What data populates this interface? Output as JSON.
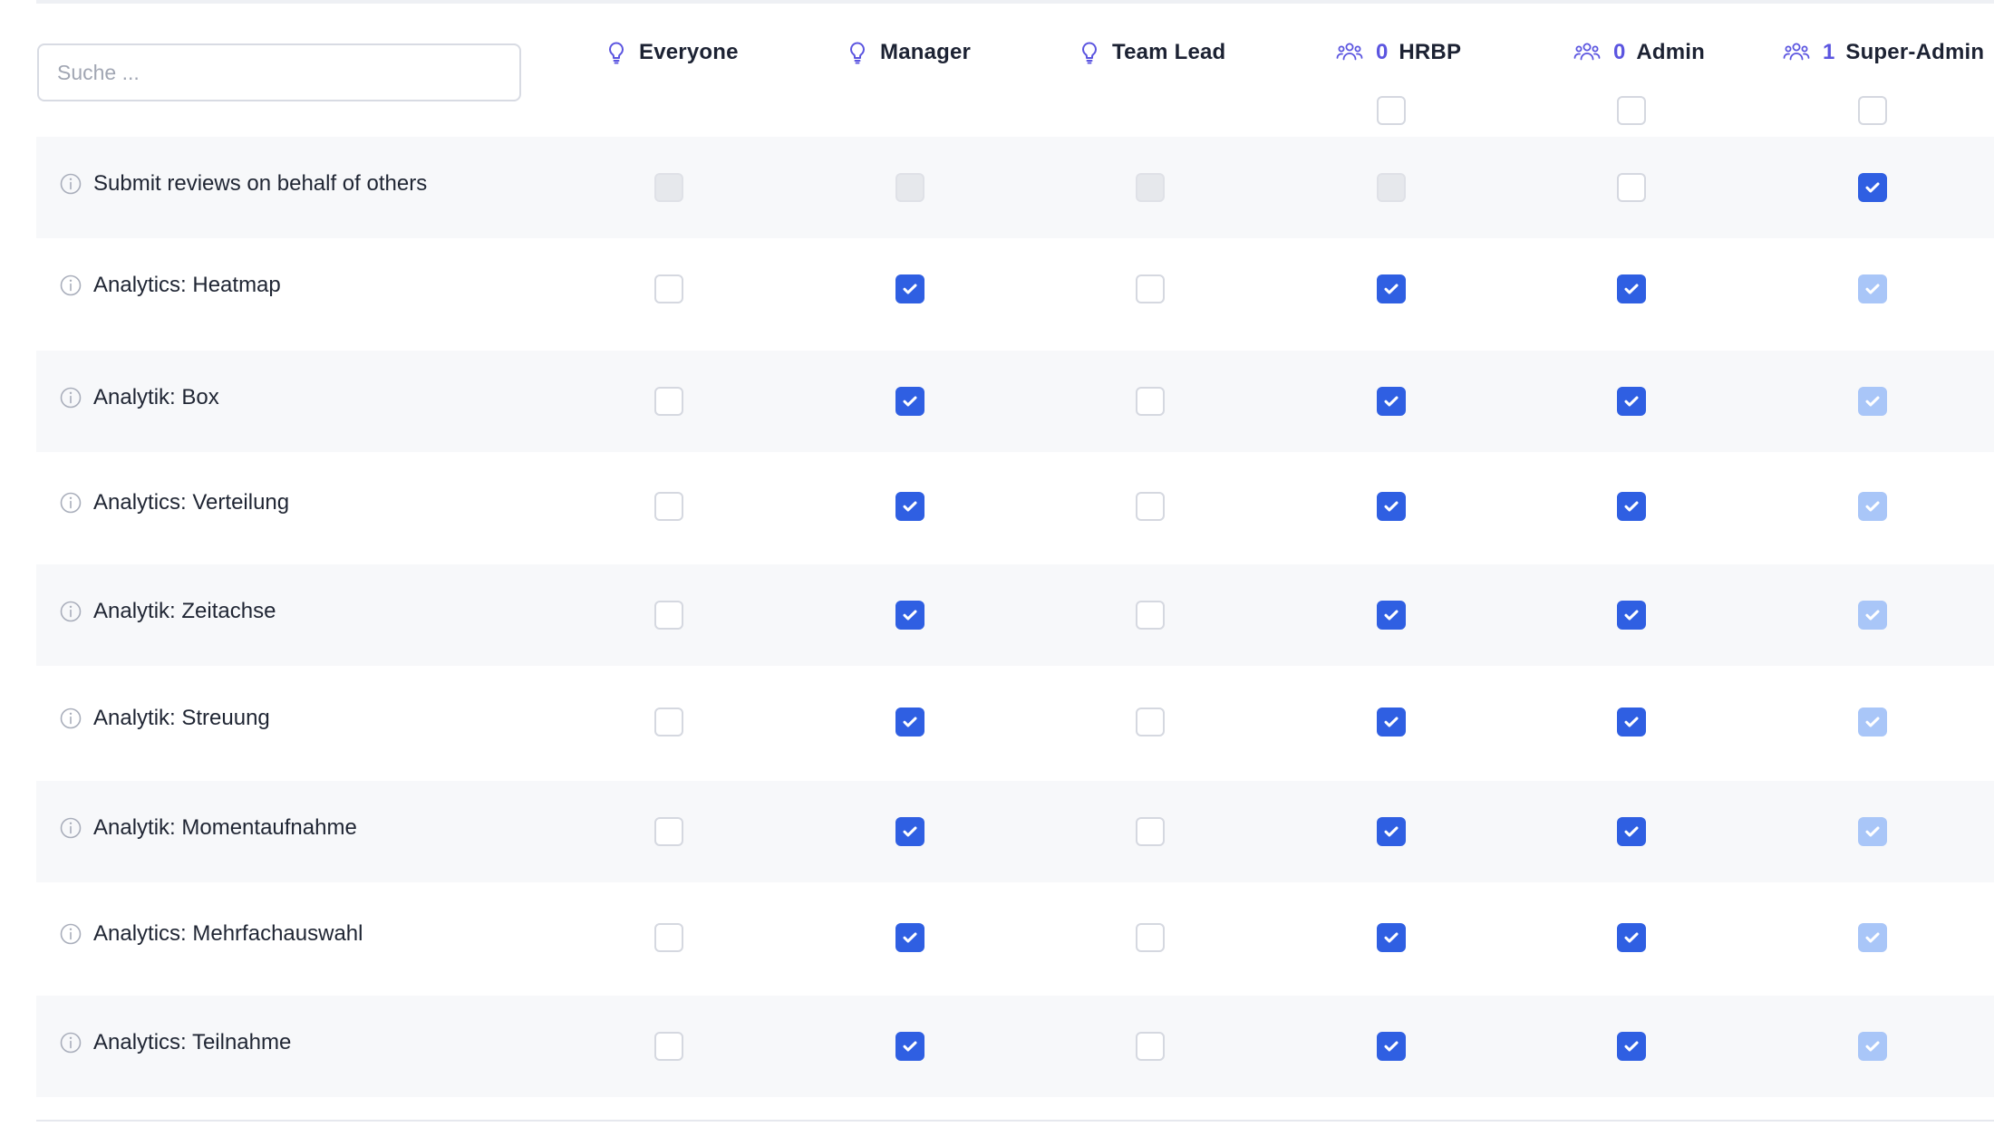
{
  "search": {
    "placeholder": "Suche ...",
    "value": ""
  },
  "colors": {
    "accent": "#2f5fe2",
    "accent_muted": "#a9c6f8",
    "role_icon": "#5b55e0",
    "row_shade": "#f7f8fa",
    "disabled_fill": "#e6e8ec"
  },
  "columns": [
    {
      "key": "everyone",
      "label": "Everyone",
      "icon": "lightbulb-icon",
      "count": ""
    },
    {
      "key": "manager",
      "label": "Manager",
      "icon": "lightbulb-icon",
      "count": ""
    },
    {
      "key": "team_lead",
      "label": "Team Lead",
      "icon": "lightbulb-icon",
      "count": ""
    },
    {
      "key": "hrbp",
      "label": "HRBP",
      "icon": "users-group-icon",
      "count": "0"
    },
    {
      "key": "admin",
      "label": "Admin",
      "icon": "users-group-icon",
      "count": "0"
    },
    {
      "key": "super_admin",
      "label": "Super-Admin",
      "icon": "users-group-icon",
      "count": "1"
    }
  ],
  "select_all": [
    "",
    "",
    "",
    "unchecked",
    "unchecked",
    "unchecked"
  ],
  "permissions": [
    {
      "label": "Submit reviews on behalf of others",
      "states": [
        "disabled",
        "disabled",
        "disabled",
        "disabled",
        "unchecked",
        "checked"
      ]
    },
    {
      "label": "Analytics: Heatmap",
      "states": [
        "unchecked",
        "checked",
        "unchecked",
        "checked",
        "checked",
        "checked-muted"
      ]
    },
    {
      "label": "Analytik: Box",
      "states": [
        "unchecked",
        "checked",
        "unchecked",
        "checked",
        "checked",
        "checked-muted"
      ]
    },
    {
      "label": "Analytics: Verteilung",
      "states": [
        "unchecked",
        "checked",
        "unchecked",
        "checked",
        "checked",
        "checked-muted"
      ]
    },
    {
      "label": "Analytik: Zeitachse",
      "states": [
        "unchecked",
        "checked",
        "unchecked",
        "checked",
        "checked",
        "checked-muted"
      ]
    },
    {
      "label": "Analytik: Streuung",
      "states": [
        "unchecked",
        "checked",
        "unchecked",
        "checked",
        "checked",
        "checked-muted"
      ]
    },
    {
      "label": "Analytik: Momentaufnahme",
      "states": [
        "unchecked",
        "checked",
        "unchecked",
        "checked",
        "checked",
        "checked-muted"
      ]
    },
    {
      "label": "Analytics: Mehrfachauswahl",
      "states": [
        "unchecked",
        "checked",
        "unchecked",
        "checked",
        "checked",
        "checked-muted"
      ]
    },
    {
      "label": "Analytics: Teilnahme",
      "states": [
        "unchecked",
        "checked",
        "unchecked",
        "checked",
        "checked",
        "checked-muted"
      ]
    }
  ]
}
